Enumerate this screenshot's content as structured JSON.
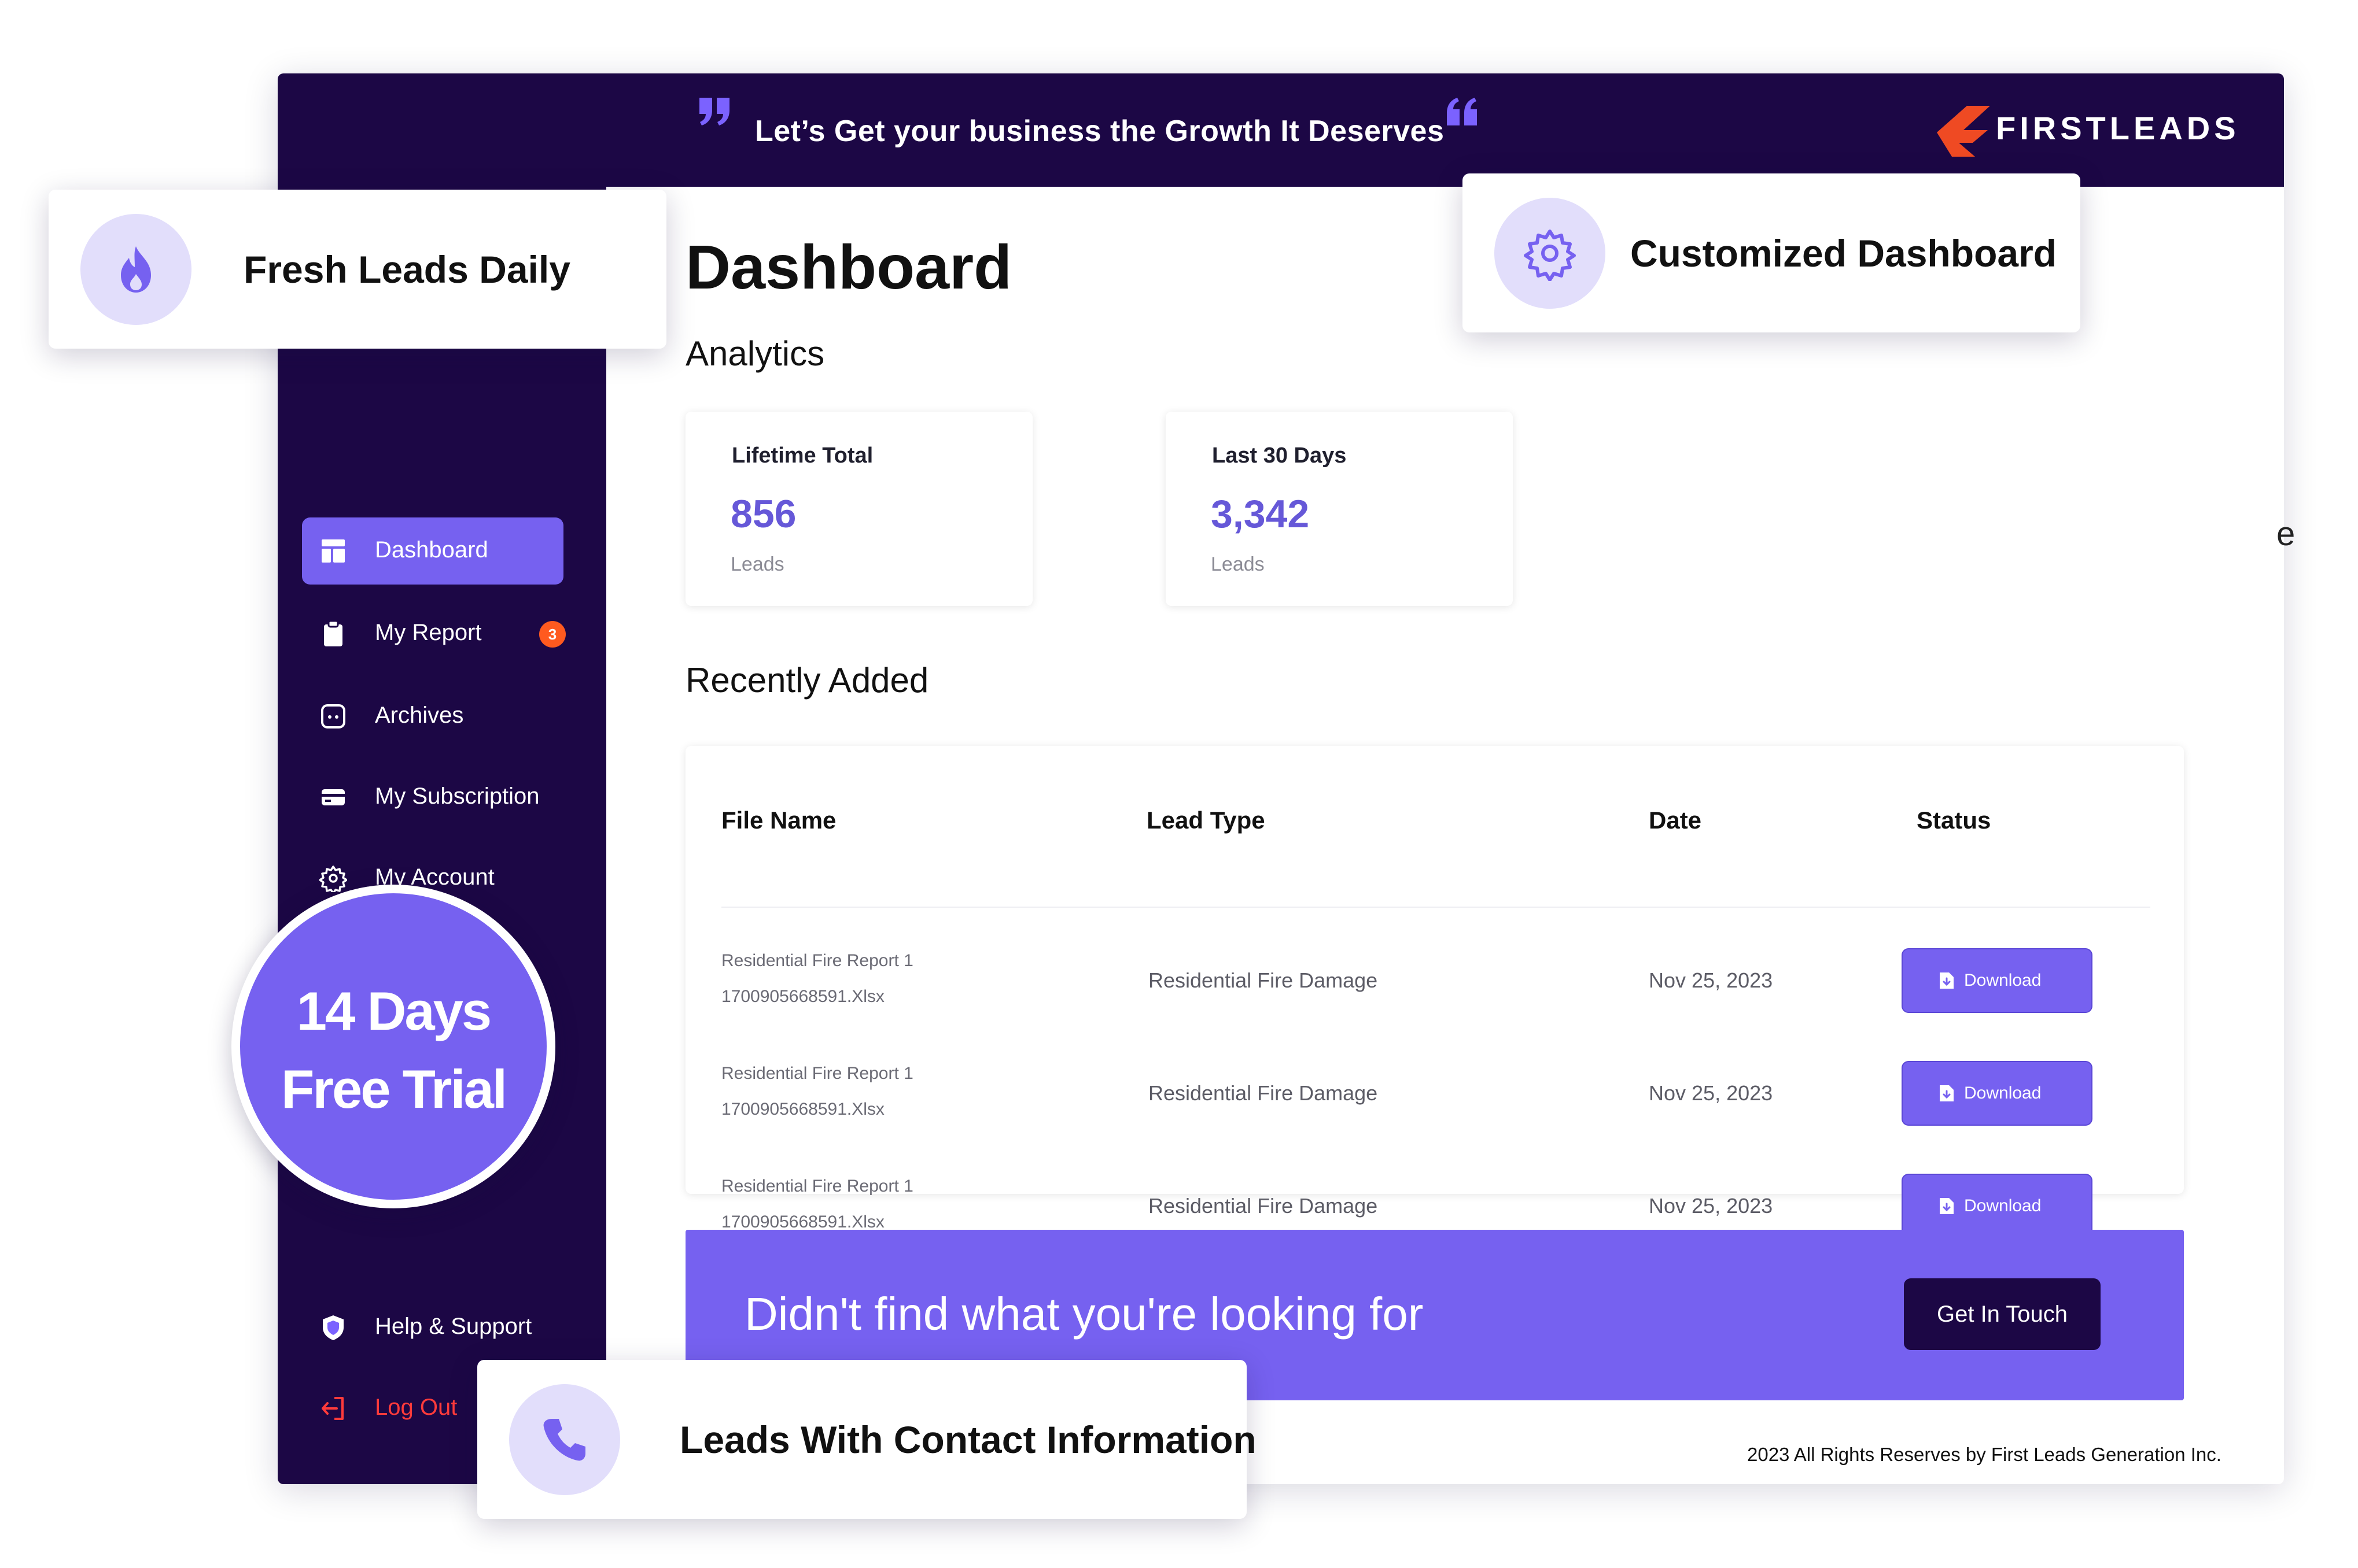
{
  "header": {
    "tagline": "Let’s Get your business the Growth It Deserves",
    "brand": "FIRSTLEADS"
  },
  "sidebar": {
    "items": [
      {
        "label": "Dashboard",
        "icon": "dashboard-icon",
        "active": true
      },
      {
        "label": "My Report",
        "icon": "clipboard-icon",
        "badge": "3"
      },
      {
        "label": "Archives",
        "icon": "archive-icon"
      },
      {
        "label": "My Subscription",
        "icon": "credit-card-icon"
      },
      {
        "label": "My Account",
        "icon": "gear-icon"
      },
      {
        "label": "Help & Support",
        "icon": "shield-icon"
      },
      {
        "label": "Log Out",
        "icon": "logout-icon"
      }
    ]
  },
  "main": {
    "title": "Dashboard",
    "analytics_title": "Analytics",
    "stats": [
      {
        "label": "Lifetime Total",
        "value": "856",
        "unit": "Leads"
      },
      {
        "label": "Last 30 Days",
        "value": "3,342",
        "unit": "Leads"
      }
    ],
    "recent_title": "Recently Added",
    "table": {
      "columns": [
        "File Name",
        "Lead Type",
        "Date",
        "Status"
      ],
      "rows": [
        {
          "file_line1": "Residential Fire Report 1",
          "file_line2": "1700905668591.Xlsx",
          "lead_type": "Residential Fire Damage",
          "date": "Nov 25, 2023",
          "action": "Download"
        },
        {
          "file_line1": "Residential Fire Report 1",
          "file_line2": "1700905668591.Xlsx",
          "lead_type": "Residential Fire Damage",
          "date": "Nov 25, 2023",
          "action": "Download"
        },
        {
          "file_line1": "Residential Fire Report 1",
          "file_line2": "1700905668591.Xlsx",
          "lead_type": "Residential Fire Damage",
          "date": "Nov 25, 2023",
          "action": "Download"
        }
      ]
    },
    "cta": {
      "text": "Didn't find what you're looking for",
      "button": "Get In Touch"
    },
    "footer": "2023 All Rights Reserves by First Leads Generation Inc.",
    "stray_letter": "e"
  },
  "feature_cards": {
    "fresh": {
      "label": "Fresh Leads Daily",
      "icon": "flame-icon"
    },
    "custom": {
      "label": "Customized Dashboard",
      "icon": "gear-icon"
    },
    "contact": {
      "label": "Leads With Contact Information",
      "icon": "phone-icon"
    }
  },
  "trial_badge": {
    "line1": "14 Days",
    "line2": "Free Trial"
  },
  "colors": {
    "navy": "#1c0745",
    "accent": "#7661f0",
    "stat_value": "#6658d8",
    "badge": "#ff5a1f",
    "logout": "#ff3b3b",
    "logo_orange": "#ef4a23"
  }
}
